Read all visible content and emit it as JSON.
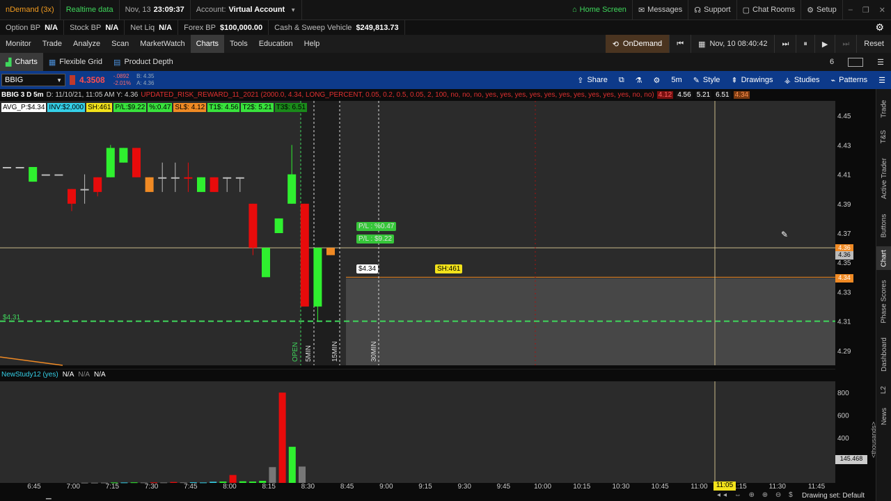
{
  "topbar": {
    "app": "nDemand (3x)",
    "realtime": "Realtime data",
    "date": "Nov, 13",
    "time": "23:09:37",
    "account_label": "Account:",
    "account_value": "Virtual Account",
    "home": "Home Screen",
    "messages": "Messages",
    "support": "Support",
    "chatrooms": "Chat Rooms",
    "setup": "Setup"
  },
  "balances": [
    {
      "label": "Option BP",
      "value": "N/A"
    },
    {
      "label": "Stock BP",
      "value": "N/A"
    },
    {
      "label": "Net Liq",
      "value": "N/A"
    },
    {
      "label": "Forex BP",
      "value": "$100,000.00"
    },
    {
      "label": "Cash & Sweep Vehicle",
      "value": "$249,813.73"
    }
  ],
  "menu": [
    "Monitor",
    "Trade",
    "Analyze",
    "Scan",
    "MarketWatch",
    "Charts",
    "Tools",
    "Education",
    "Help"
  ],
  "menu_active": "Charts",
  "ondemand": {
    "label": "OnDemand",
    "datetime": "Nov, 10 08:40:42",
    "reset": "Reset"
  },
  "subtabs": [
    "Charts",
    "Flexible Grid",
    "Product Depth"
  ],
  "grid_count": "6",
  "symbolbar": {
    "symbol": "BBIG",
    "price": "4.3508",
    "change": "-.0892",
    "change_pct": "-2.01%",
    "bid": "B: 4.35",
    "ask": "A: 4.36",
    "share": "Share",
    "timeframe": "5m",
    "style": "Style",
    "drawings": "Drawings",
    "studies": "Studies",
    "patterns": "Patterns"
  },
  "chart_header": {
    "title": "BBIG 3 D 5m",
    "info": "D: 11/10/21, 11:05 AM  Y: 4.36",
    "study": "UPDATED_RISK_REWARD_11_2021 (2000.0, 4.34, LONG_PERCENT, 0.05, 0.2, 0.5, 0.05, 2, 100, no, no, no, yes, yes, yes, yes, yes, yes, yes, yes, yes, yes, no, no)",
    "v1": "4.12",
    "v2": "4.56",
    "v3": "5.21",
    "v4": "6.51",
    "v5": "4.34"
  },
  "badges": [
    {
      "text": "AVG_P:$4.34",
      "bg": "#ffffff",
      "fg": "#000000"
    },
    {
      "text": "INV:$2,000",
      "bg": "#35d0e8",
      "fg": "#000000"
    },
    {
      "text": "SH:461",
      "bg": "#f2e21b",
      "fg": "#000000"
    },
    {
      "text": "P/L:$9.22",
      "bg": "#38e23c",
      "fg": "#000000"
    },
    {
      "text": "%:0.47",
      "bg": "#38e23c",
      "fg": "#000000"
    },
    {
      "text": "SL$: 4.12",
      "bg": "#f08a24",
      "fg": "#000000"
    },
    {
      "text": "T1$: 4.56",
      "bg": "#38e23c",
      "fg": "#000000"
    },
    {
      "text": "T2$: 5.21",
      "bg": "#38e23c",
      "fg": "#000000"
    },
    {
      "text": "T3$: 6.51",
      "bg": "#1a8a1a",
      "fg": "#000000"
    }
  ],
  "price_labels": {
    "tag_431": "$4.31",
    "pl_pct": "P/L : %0.47",
    "pl_usd": "P/L : $9.22",
    "entry": "$4.34",
    "shares": "SH:461",
    "cur1": "4.36",
    "cur2": "4.36",
    "cur3": "4.34",
    "open": "OPEN",
    "m5": "5MIN",
    "m15": "15MIN",
    "m30": "30MIN"
  },
  "lower_header": {
    "name": "NewStudy12 (yes)",
    "v1": "N/A",
    "v2": "N/A",
    "v3": "N/A"
  },
  "volume_axis": {
    "unit": "<thousands>",
    "current": "145.468"
  },
  "time_cursor": "11:05",
  "status": {
    "drawing_set": "Drawing set: Default"
  },
  "rail_tabs": [
    "Trade",
    "T&S",
    "Active Trader",
    "Buttons",
    "Chart",
    "Phase Scores",
    "Dashboard",
    "L2",
    "News"
  ],
  "rail_active": "Chart",
  "chart_data": {
    "type": "candlestick",
    "x": [
      "6:45",
      "7:00",
      "7:15",
      "7:30",
      "7:45",
      "8:00",
      "8:15",
      "8:30",
      "8:45",
      "9:00",
      "9:15",
      "9:30",
      "9:45",
      "10:00",
      "10:15",
      "10:30",
      "10:45",
      "11:00",
      "11:15",
      "11:30",
      "11:45"
    ],
    "y_ticks": [
      4.29,
      4.31,
      4.33,
      4.35,
      4.37,
      4.39,
      4.41,
      4.43,
      4.45
    ],
    "ylim": [
      4.28,
      4.46
    ],
    "candles": [
      {
        "o": 4.415,
        "h": 4.415,
        "l": 4.415,
        "c": 4.415,
        "color": "flat"
      },
      {
        "o": 4.415,
        "h": 4.415,
        "l": 4.415,
        "c": 4.415,
        "color": "flat"
      },
      {
        "o": 4.405,
        "h": 4.415,
        "l": 4.405,
        "c": 4.415,
        "color": "green"
      },
      {
        "o": 4.41,
        "h": 4.41,
        "l": 4.41,
        "c": 4.41,
        "color": "flat"
      },
      {
        "o": 4.41,
        "h": 4.41,
        "l": 4.41,
        "c": 4.41,
        "color": "flat"
      },
      {
        "o": 4.4,
        "h": 4.4,
        "l": 4.385,
        "c": 4.39,
        "color": "red"
      },
      {
        "o": 4.4,
        "h": 4.41,
        "l": 4.39,
        "c": 4.4,
        "color": "flat"
      },
      {
        "o": 4.408,
        "h": 4.408,
        "l": 4.395,
        "c": 4.398,
        "color": "red"
      },
      {
        "o": 4.408,
        "h": 4.43,
        "l": 4.408,
        "c": 4.428,
        "color": "green"
      },
      {
        "o": 4.428,
        "h": 4.428,
        "l": 4.418,
        "c": 4.418,
        "color": "green"
      },
      {
        "o": 4.428,
        "h": 4.428,
        "l": 4.408,
        "c": 4.408,
        "color": "red"
      },
      {
        "o": 4.408,
        "h": 4.408,
        "l": 4.398,
        "c": 4.398,
        "color": "orange"
      },
      {
        "o": 4.408,
        "h": 4.418,
        "l": 4.398,
        "c": 4.408,
        "color": "flat"
      },
      {
        "o": 4.408,
        "h": 4.418,
        "l": 4.398,
        "c": 4.408,
        "color": "flat"
      },
      {
        "o": 4.408,
        "h": 4.418,
        "l": 4.398,
        "c": 4.408,
        "color": "red"
      },
      {
        "o": 4.398,
        "h": 4.408,
        "l": 4.398,
        "c": 4.408,
        "color": "green"
      },
      {
        "o": 4.408,
        "h": 4.408,
        "l": 4.398,
        "c": 4.398,
        "color": "red"
      },
      {
        "o": 4.408,
        "h": 4.408,
        "l": 4.398,
        "c": 4.408,
        "color": "flat"
      },
      {
        "o": 4.408,
        "h": 4.408,
        "l": 4.398,
        "c": 4.408,
        "color": "flat"
      },
      {
        "o": 4.39,
        "h": 4.39,
        "l": 4.355,
        "c": 4.36,
        "color": "red"
      },
      {
        "o": 4.34,
        "h": 4.36,
        "l": 4.34,
        "c": 4.36,
        "color": "green"
      },
      {
        "o": 4.37,
        "h": 4.38,
        "l": 4.37,
        "c": 4.38,
        "color": "green"
      },
      {
        "o": 4.39,
        "h": 4.43,
        "l": 4.39,
        "c": 4.41,
        "color": "green"
      },
      {
        "o": 4.39,
        "h": 4.39,
        "l": 4.32,
        "c": 4.32,
        "color": "red"
      },
      {
        "o": 4.32,
        "h": 4.36,
        "l": 4.31,
        "c": 4.36,
        "color": "green"
      },
      {
        "o": 4.36,
        "h": 4.36,
        "l": 4.355,
        "c": 4.355,
        "color": "orange"
      }
    ],
    "volume_ticks": [
      200,
      400,
      600,
      800
    ],
    "volume_ylim": [
      0,
      900
    ],
    "volume": [
      {
        "v": 2,
        "color": "gray"
      },
      {
        "v": 2,
        "color": "gray"
      },
      {
        "v": 3,
        "color": "gray"
      },
      {
        "v": 4,
        "color": "green"
      },
      {
        "v": 4,
        "color": "cyan"
      },
      {
        "v": 5,
        "color": "green"
      },
      {
        "v": 4,
        "color": "gray"
      },
      {
        "v": 5,
        "color": "red"
      },
      {
        "v": 4,
        "color": "gray"
      },
      {
        "v": 8,
        "color": "red"
      },
      {
        "v": 5,
        "color": "gray"
      },
      {
        "v": 6,
        "color": "cyan"
      },
      {
        "v": 4,
        "color": "cyan"
      },
      {
        "v": 10,
        "color": "cyan"
      },
      {
        "v": 12,
        "color": "green"
      },
      {
        "v": 70,
        "color": "red"
      },
      {
        "v": 14,
        "color": "green"
      },
      {
        "v": 12,
        "color": "green"
      },
      {
        "v": 18,
        "color": "green"
      },
      {
        "v": 140,
        "color": "gray"
      },
      {
        "v": 800,
        "color": "red"
      },
      {
        "v": 320,
        "color": "green"
      },
      {
        "v": 145,
        "color": "gray"
      }
    ]
  }
}
